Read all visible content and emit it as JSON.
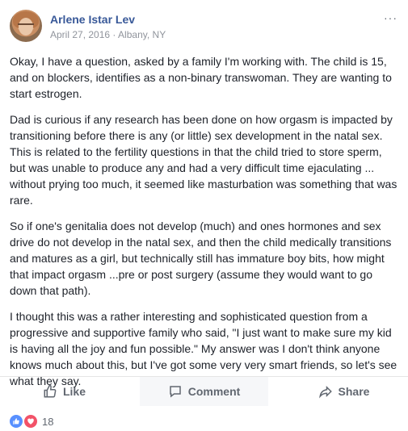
{
  "post": {
    "author": "Arlene Istar Lev",
    "date_location": "April 27, 2016 · Albany, NY",
    "more_label": "···",
    "paragraphs": [
      "Okay, I have a question, asked by a family I'm working with. The child is 15, and on blockers, identifies as a non-binary transwoman. They are wanting to start estrogen.",
      "Dad is curious if any research has been done on how orgasm is impacted by transitioning before there is any (or little) sex development in the natal sex. This is related to the fertility questions in that the child tried to store sperm, but was unable to produce any and had a very difficult time ejaculating ... without prying too much, it seemed like masturbation was something that was rare.",
      "So if one's genitalia does not develop (much) and ones hormones and sex drive do not develop in the natal sex, and then the child medically transitions and matures as a girl, but technically still has immature boy bits, how might that impact orgasm ...pre or post surgery (assume they would want to go down that path).",
      "I thought this was a rather interesting and sophisticated question from a progressive and supportive family who said, \"I just want to make sure my kid is having all the joy and fun possible.\" My answer was I don't think anyone knows much about this, but I've got some very very smart friends, so let's see what they say."
    ]
  },
  "actions": {
    "like_label": "Like",
    "comment_label": "Comment",
    "share_label": "Share"
  },
  "reactions": {
    "count": "18",
    "types": [
      "like",
      "love"
    ],
    "colors": {
      "like": "#5890ff",
      "love": "#f25268"
    }
  }
}
